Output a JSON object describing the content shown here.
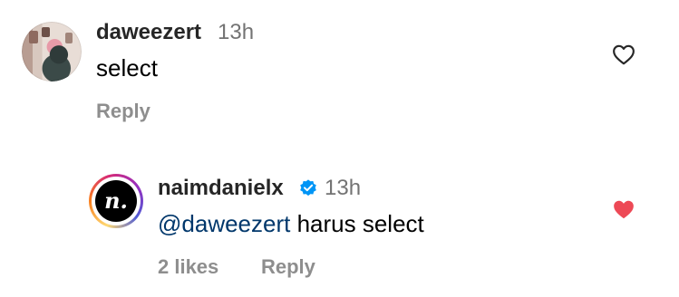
{
  "comments": [
    {
      "username": "daweezert",
      "time": "13h",
      "text": "select",
      "reply_label": "Reply",
      "liked": false,
      "avatar_icon": "profile-photo-avatar"
    },
    {
      "username": "naimdanielx",
      "verified": true,
      "time": "13h",
      "mention": "@daweezert",
      "text": " harus select",
      "likes_label": "2 likes",
      "reply_label": "Reply",
      "liked": true,
      "avatar_logo": "n.",
      "avatar_icon": "logo-avatar"
    }
  ],
  "colors": {
    "username": "#262626",
    "timestamp": "#737373",
    "meta": "#8e8e8e",
    "mention": "#00376b",
    "liked_heart": "#ed4956",
    "verified_badge": "#0095f6"
  }
}
